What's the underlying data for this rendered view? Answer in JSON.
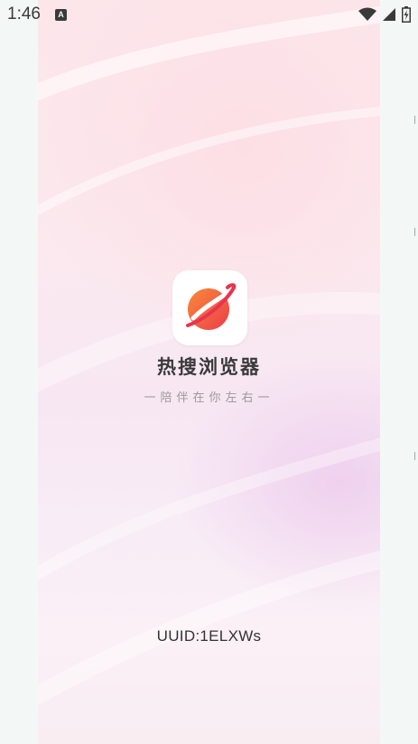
{
  "status_bar": {
    "time": "1:46",
    "notification_icon_label": "A",
    "icons": [
      "wifi-icon",
      "cell-signal-icon",
      "battery-charging-icon"
    ]
  },
  "splash": {
    "app_name": "热搜浏览器",
    "tagline": "一陪伴在你左右一",
    "uuid": "UUID:1ELXWs",
    "logo_icon": "planet-logo-icon"
  },
  "colors": {
    "accent_orange": "#f46a3c",
    "accent_red": "#e8344e",
    "background": "#fce6ea",
    "outer_background": "#f3f8f7"
  }
}
